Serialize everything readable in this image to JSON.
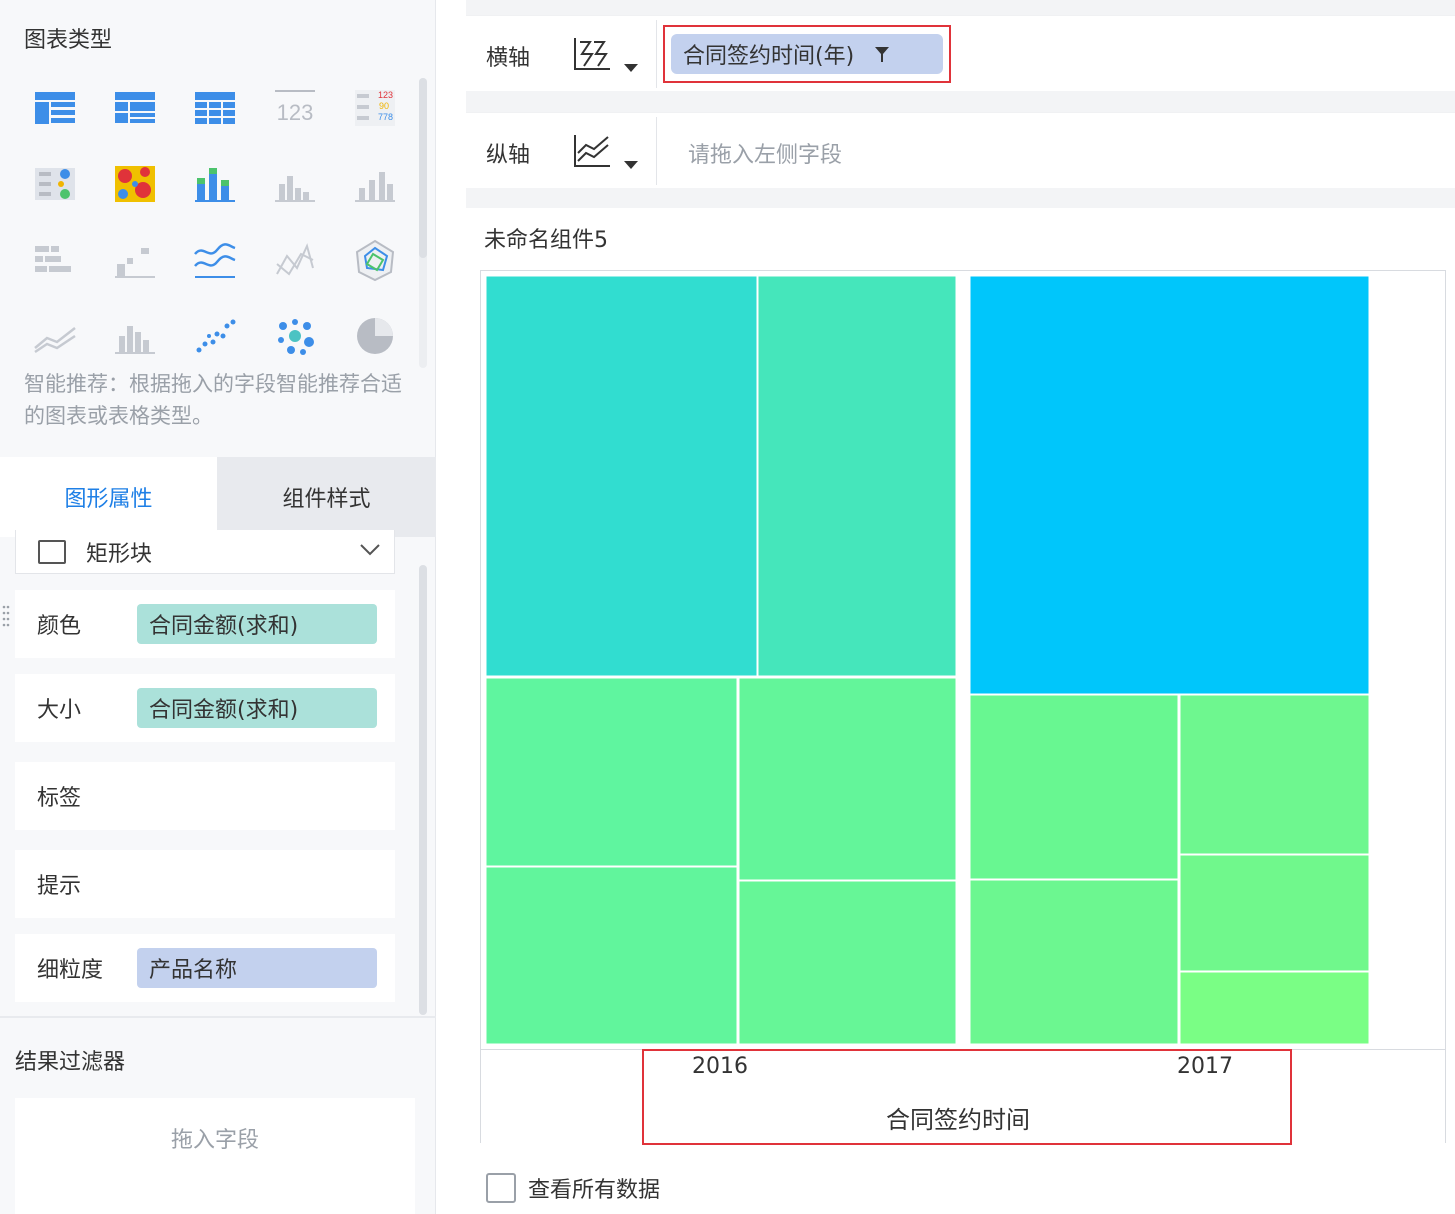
{
  "left_panel": {
    "chart_types_title": "图表类型",
    "chart_type_icons": [
      "table-icon",
      "group-table-icon",
      "cross-table-icon",
      "kpi-number-icon",
      "color-table-icon",
      "dot-legend-icon",
      "heatmap-icon",
      "stacked-bar-icon",
      "column-chart-icon",
      "multi-column-chart-icon",
      "bar-split-icon",
      "step-chart-icon",
      "multi-line-icon",
      "radar-line-icon",
      "radar-icon",
      "area-line-icon",
      "grouped-column-icon",
      "scatter-icon",
      "bubble-icon",
      "pie-icon"
    ],
    "recommend_text": "智能推荐：根据拖入的字段智能推荐合适的图表或表格类型。",
    "tabs": {
      "graphic": "图形属性",
      "style": "组件样式"
    },
    "shape_select": {
      "label": "矩形块"
    },
    "properties": {
      "color": {
        "label": "颜色",
        "value": "合同金额(求和)"
      },
      "size": {
        "label": "大小",
        "value": "合同金额(求和)"
      },
      "label": {
        "label": "标签"
      },
      "tooltip": {
        "label": "提示"
      },
      "granularity": {
        "label": "细粒度",
        "value": "产品名称"
      }
    },
    "result_filter": {
      "title": "结果过滤器",
      "placeholder": "拖入字段"
    }
  },
  "right_panel": {
    "x_axis": {
      "label": "横轴",
      "field": "合同签约时间(年)"
    },
    "y_axis": {
      "label": "纵轴",
      "placeholder": "请拖入左侧字段"
    },
    "widget_title": "未命名组件5",
    "view_all_label": "查看所有数据"
  },
  "colors": {
    "highlight": "#e0333a",
    "accent": "#1e7fe6",
    "chip_green": "#abe1da",
    "chip_blue": "#c3d1ee"
  },
  "chart_data": {
    "type": "treemap",
    "xlabel": "合同签约时间",
    "categories": [
      "2016",
      "2017"
    ],
    "groups": [
      {
        "name": "2016",
        "color": [
          "#31ddd0",
          "#45e6bb",
          "#5ff59f",
          "#63f59a",
          "#61f59c",
          "#66f697"
        ]
      },
      {
        "name": "2017",
        "color": [
          "#00c6fb",
          "#68f791",
          "#6ef78f",
          "#70f88c",
          "#6cf790",
          "#7afe85"
        ]
      }
    ]
  }
}
